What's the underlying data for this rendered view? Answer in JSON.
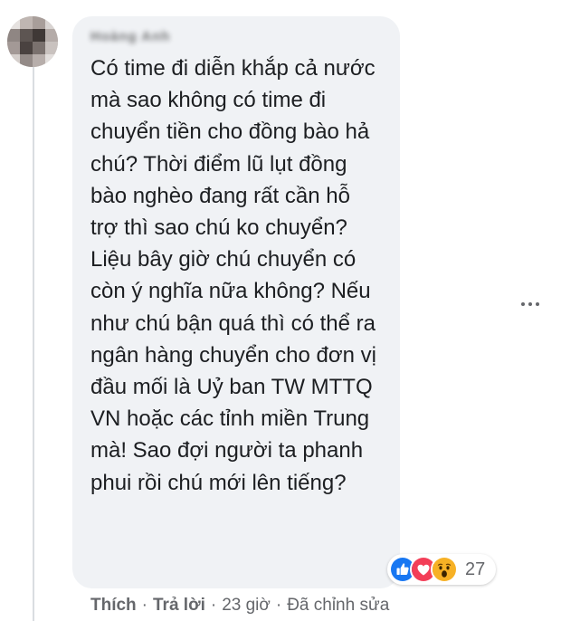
{
  "comment": {
    "author_name": "Hoàng Anh",
    "text": "Có time đi diễn khắp cả nước mà sao không có time đi chuyển tiền cho đồng bào hả chú? Thời điểm lũ lụt đồng bào nghèo đang rất cần hỗ trợ thì sao chú ko chuyển? Liệu bây giờ chú chuyển có còn ý nghĩa nữa không? Nếu như chú bận quá thì có thể ra ngân hàng chuyển cho đơn vị đầu mối là Uỷ ban TW MTTQ VN hoặc các tỉnh miền Trung mà! Sao đợi người ta phanh phui rồi chú mới lên tiếng?",
    "reactions": {
      "icons": [
        "like-icon",
        "love-icon",
        "wow-icon"
      ],
      "count": "27"
    },
    "actions": {
      "like": "Thích",
      "reply": "Trả lời",
      "time": "23 giờ",
      "edited": "Đã chỉnh sửa",
      "separator": "·"
    }
  },
  "colors": {
    "bubble": "#f0f2f5",
    "text": "#1c1e21",
    "secondary": "#65676b",
    "like_blue": "#1877f2",
    "love_red": "#f33e58",
    "wow_yellow": "#f7b125"
  }
}
